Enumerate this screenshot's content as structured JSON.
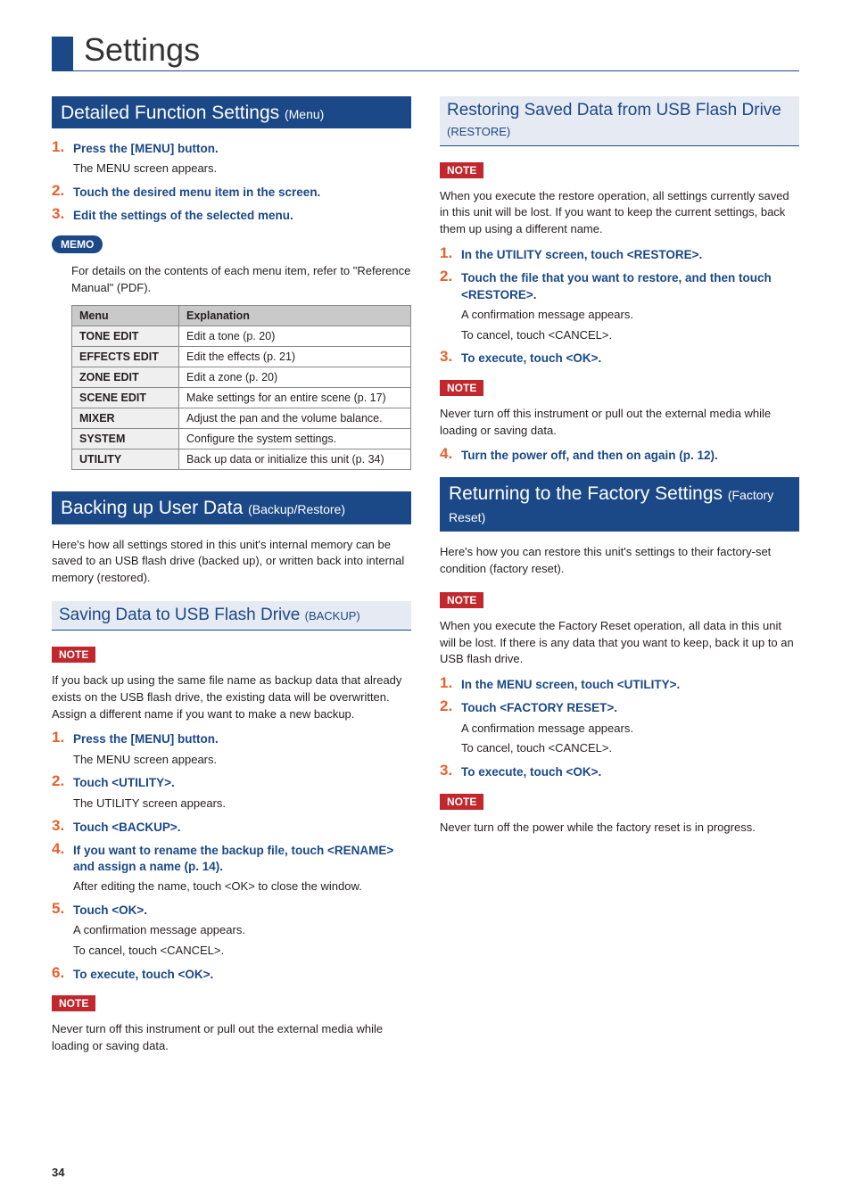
{
  "page": {
    "title": "Settings",
    "number": "34"
  },
  "left": {
    "sec1": {
      "heading": "Detailed Function Settings ",
      "heading_paren": "(Menu)",
      "steps": [
        {
          "bold": "Press the [MENU] button.",
          "sub": "The MENU screen appears."
        },
        {
          "bold": "Touch the desired menu item in the screen."
        },
        {
          "bold": "Edit the settings of the selected menu."
        }
      ],
      "memo_label": "MEMO",
      "memo_text": "For details on the contents of each menu item, refer to \"Reference Manual\" (PDF).",
      "table": {
        "head_menu": "Menu",
        "head_exp": "Explanation",
        "rows": [
          {
            "m": "TONE EDIT",
            "e": "Edit a tone (p. 20)"
          },
          {
            "m": "EFFECTS EDIT",
            "e": "Edit the effects (p. 21)"
          },
          {
            "m": "ZONE EDIT",
            "e": "Edit a zone (p. 20)"
          },
          {
            "m": "SCENE EDIT",
            "e": "Make settings for an entire scene (p. 17)"
          },
          {
            "m": "MIXER",
            "e": "Adjust the pan and the volume balance."
          },
          {
            "m": "SYSTEM",
            "e": "Configure the system settings."
          },
          {
            "m": "UTILITY",
            "e": "Back up data or initialize this unit (p. 34)"
          }
        ]
      }
    },
    "sec2": {
      "heading": "Backing up User Data ",
      "heading_paren": "(Backup/Restore)",
      "intro": "Here's how all settings stored in this unit's internal memory can be saved to an USB flash drive (backed up), or written back into internal memory (restored).",
      "sub1_heading": "Saving Data to USB Flash Drive ",
      "sub1_paren": "(BACKUP)",
      "note_label": "NOTE",
      "note1": "If you back up using the same file name as backup data that already exists on the USB flash drive, the existing data will be overwritten. Assign a different name if you want to make a new backup.",
      "steps": [
        {
          "bold": "Press the [MENU] button.",
          "sub": "The MENU screen appears."
        },
        {
          "bold": "Touch <UTILITY>.",
          "sub": "The UTILITY screen appears."
        },
        {
          "bold": "Touch <BACKUP>."
        },
        {
          "bold": "If you want to rename the backup file, touch <RENAME> and assign a name (p. 14).",
          "sub": "After editing the name, touch <OK> to close the window."
        },
        {
          "bold": "Touch <OK>.",
          "sub": "A confirmation message appears.",
          "sub2": "To cancel, touch <CANCEL>."
        },
        {
          "bold": "To execute, touch <OK>."
        }
      ],
      "note2": "Never turn off this instrument or pull out the external media while loading or saving data."
    }
  },
  "right": {
    "sub1_heading": "Restoring Saved Data from USB Flash Drive ",
    "sub1_paren": "(RESTORE)",
    "note_label": "NOTE",
    "note1": "When you execute the restore operation, all settings currently saved in this unit will be lost. If you want to keep the current settings, back them up using a different name.",
    "steps1": [
      {
        "bold": "In the UTILITY screen, touch <RESTORE>."
      },
      {
        "bold": "Touch the file that you want to restore, and then touch <RESTORE>.",
        "sub": "A confirmation message appears.",
        "sub2": "To cancel, touch <CANCEL>."
      },
      {
        "bold": "To execute, touch <OK>."
      }
    ],
    "note2": "Never turn off this instrument or pull out the external media while loading or saving data.",
    "step4": {
      "bold": "Turn the power off, and then on again (p. 12)."
    },
    "sec2_heading": "Returning to the Factory Settings ",
    "sec2_paren": "(Factory Reset)",
    "sec2_intro": "Here's how you can restore this unit's settings to their factory-set condition (factory reset).",
    "note3": "When you execute the Factory Reset operation, all data in this unit will be lost. If there is any data that you want to keep, back it up to an USB flash drive.",
    "steps2": [
      {
        "bold": "In the MENU screen, touch <UTILITY>."
      },
      {
        "bold": "Touch <FACTORY RESET>.",
        "sub": "A confirmation message appears.",
        "sub2": "To cancel, touch <CANCEL>."
      },
      {
        "bold": "To execute, touch <OK>."
      }
    ],
    "note4": "Never turn off the power while the factory reset is in progress."
  }
}
